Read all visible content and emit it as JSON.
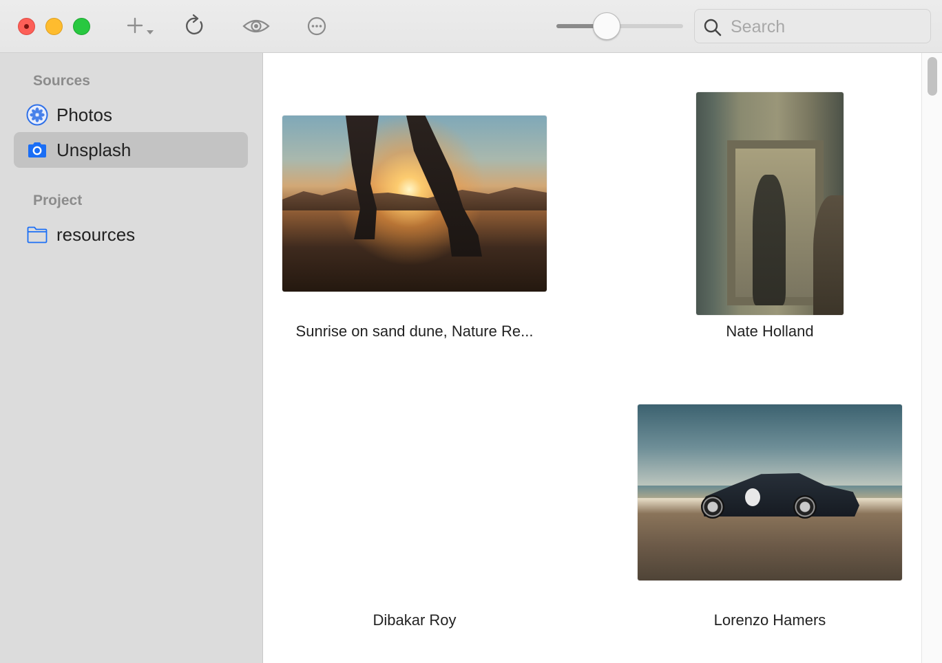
{
  "toolbar": {
    "add_icon": "plus-dropdown-icon",
    "refresh_icon": "refresh-icon",
    "preview_icon": "eye-icon",
    "more_icon": "ellipsis-circle-icon",
    "zoom_level": 0.37,
    "search": {
      "placeholder": "Search",
      "value": ""
    }
  },
  "sidebar": {
    "sections": [
      {
        "title": "Sources",
        "items": [
          {
            "label": "Photos",
            "icon": "photos-icon",
            "selected": false
          },
          {
            "label": "Unsplash",
            "icon": "camera-icon",
            "selected": true
          }
        ]
      },
      {
        "title": "Project",
        "items": [
          {
            "label": "resources",
            "icon": "folder-icon",
            "selected": false
          }
        ]
      }
    ]
  },
  "grid": {
    "items": [
      {
        "caption": "Sunrise on sand dune, Nature Re...",
        "image": "desert-sunrise-photo"
      },
      {
        "caption": "Nate Holland",
        "image": "mirror-portrait-photo"
      },
      {
        "caption": "Dibakar Roy",
        "image": ""
      },
      {
        "caption": "Lorenzo Hamers",
        "image": "car-on-beach-photo"
      }
    ]
  },
  "colors": {
    "accent": "#1a6ef5",
    "sidebar_bg": "#dcdcdc",
    "selected_bg": "#c3c3c3",
    "close": "#fd5f57",
    "minimize": "#febc2e",
    "maximize": "#28c840"
  }
}
